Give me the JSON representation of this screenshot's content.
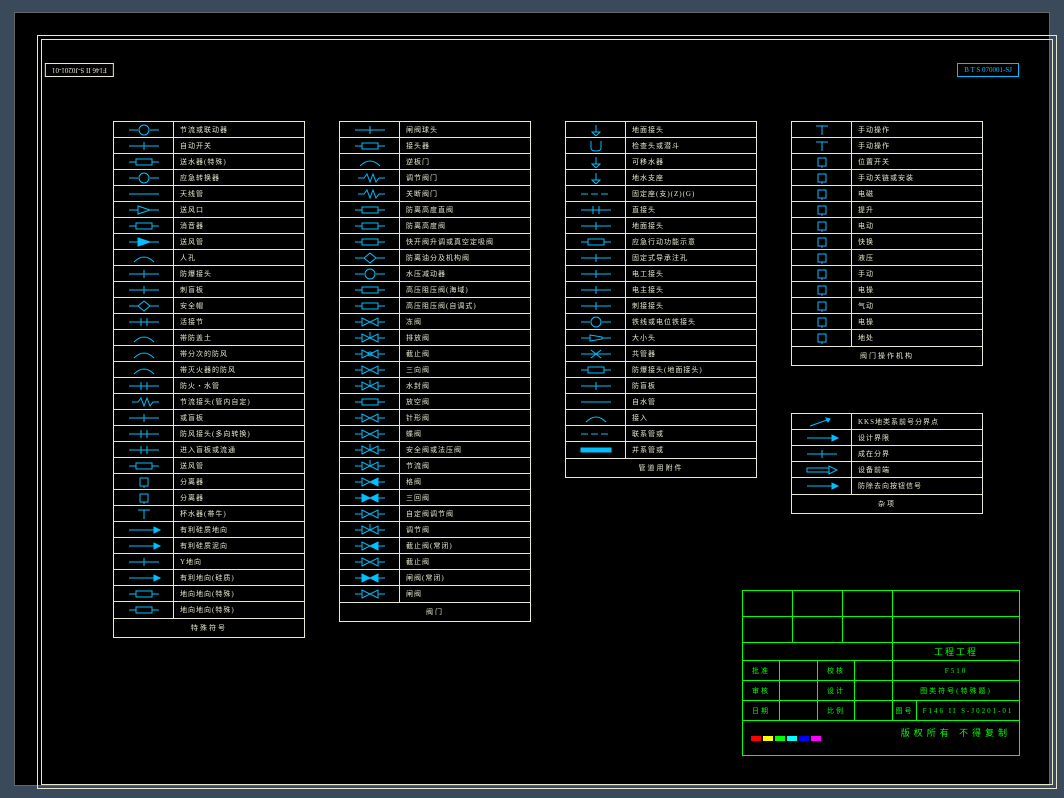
{
  "stamps": {
    "tl": "F146 II S-J0201-01",
    "tr": "B T S 070001-SJ"
  },
  "t1": {
    "title": "特殊符号",
    "rows": [
      "节流或联动器",
      "自动开关",
      "送水器(特殊)",
      "应急转换器",
      "天线管",
      "送风口",
      "消音器",
      "送风管",
      "人孔",
      "防爆接头",
      "刺盲板",
      "安全帽",
      "活接节",
      "帯防盖土",
      "帯分次的防风",
      "帯灭火器的防风",
      "防火・水管",
      "节流接头(管内自定)",
      "或盲板",
      "防风接头(多向转换)",
      "进入盲板或流通",
      "送风管",
      "分离器",
      "分离器",
      "杯水器(帯牛)",
      "有利硅质地向",
      "有利硅质泥向",
      "Y地向",
      "有利地向(硅质)",
      "地向地向(特殊)",
      "地向地向(特殊)"
    ]
  },
  "t2": {
    "title": "阀门",
    "rows": [
      "闸阀球头",
      "接头器",
      "逆板门",
      "调节阀门",
      "关断阀门",
      "防离高度直阀",
      "防离高度阀",
      "快开阀升调或真空定吸阀",
      "防离油分及机构阀",
      "水压减动器",
      "高压阻压阀(海域)",
      "高压阻压阀(自调式)",
      "冻阀",
      "排放阀",
      "截止阀",
      "三向阀",
      "水封阀",
      "放空阀",
      "针形阀",
      "蝶阀",
      "安全阀或法压阀",
      "节流阀",
      "格阀",
      "三回阀",
      "自定阀调节阀",
      "调节阀",
      "截止阀(常闭)",
      "截止阀",
      "闸阀(常闭)",
      "闸阀"
    ]
  },
  "t3": {
    "title": "管道用附件",
    "rows": [
      "地面接头",
      "检查头或潜斗",
      "可移水器",
      "地水支座",
      "固定座(支)(Z)(G)",
      "直接头",
      "地面接头",
      "应急行动功能示意",
      "固定式导承注孔",
      "电工接头",
      "电主接头",
      "刺接接头",
      "铁线或电位铁接头",
      "大小头",
      "共管器",
      "防爆接头(地面接头)",
      "防盲板",
      "自水管",
      "接入",
      "联系管或",
      "并系管或"
    ]
  },
  "t4": {
    "title": "阀门操作机构",
    "rows": [
      "手动操作",
      "手动操作",
      "位置开关",
      "手动关链或安装",
      "电磁",
      "提升",
      "电动",
      "快换",
      "液压",
      "手动",
      "电操",
      "气动",
      "电操",
      "地处"
    ]
  },
  "t5": {
    "title": "杂项",
    "rows": [
      "KKS地类系前号分界点",
      "设计界限",
      "成在分界",
      "设备前端",
      "防除去向按钮信号"
    ]
  },
  "titleblock": {
    "approve": "批准",
    "check": "校核",
    "review": "审核",
    "design": "设计",
    "date": "日期",
    "scale": "比例",
    "code": "F510",
    "desc": "图类符号(特殊题)",
    "num_label": "图号",
    "num": "F146 II S-J0201-01",
    "copyright": "版权所有  不得复制",
    "project": "工程工程"
  }
}
